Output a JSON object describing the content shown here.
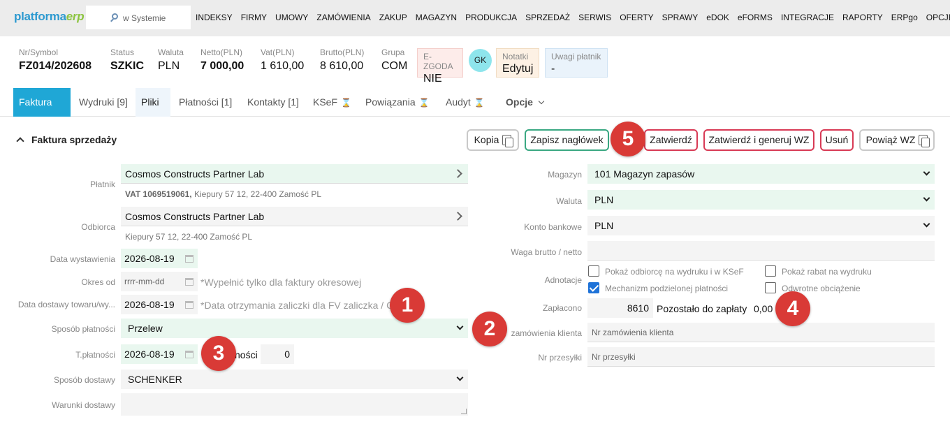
{
  "nav": {
    "logo_a": "platforma",
    "logo_b": "erp",
    "search_placeholder": "w Systemie",
    "menu": [
      "INDEKSY",
      "FIRMY",
      "UMOWY",
      "ZAMÓWIENIA",
      "ZAKUP",
      "MAGAZYN",
      "PRODUKCJA",
      "SPRZEDAŻ",
      "SERWIS",
      "OFERTY",
      "SPRAWY",
      "eDOK",
      "eFORMS",
      "INTEGRACJE",
      "RAPORTY",
      "ERPgo",
      "OPCJE"
    ]
  },
  "header": {
    "nr_label": "Nr/Symbol",
    "nr_value": "FZ014/202608",
    "status_label": "Status",
    "status_value": "SZKIC",
    "waluta_label": "Waluta",
    "waluta_value": "PLN",
    "netto_label": "Netto(PLN)",
    "netto_value": "7 000,00",
    "vat_label": "Vat(PLN)",
    "vat_value": "1 610,00",
    "brutto_label": "Brutto(PLN)",
    "brutto_value": "8 610,00",
    "grupa_label": "Grupa",
    "grupa_value": "COM",
    "ezgoda_label": "E-ZGODA",
    "ezgoda_value": "NIE",
    "avatar": "GK",
    "notatki_label": "Notatki",
    "notatki_value": "Edytuj",
    "uwagi_label": "Uwagi płatnik",
    "uwagi_value": "-",
    "colors": {
      "ezgoda_bg": "#fdecea",
      "notatki_bg": "#fdf1e4",
      "uwagi_bg": "#eaf3fb",
      "accent": "#1fa7d6"
    }
  },
  "tabs": {
    "faktura": "Faktura [1]",
    "wydruki": "Wydruki [9]",
    "pliki": "Pliki",
    "platnosci": "Płatności [1]",
    "kontakty": "Kontakty [1]",
    "ksef": "KSeF",
    "powiazania": "Powiązania",
    "audyt": "Audyt",
    "opcje": "Opcje"
  },
  "section": {
    "title": "Faktura sprzedaży",
    "buttons": {
      "kopia": "Kopia",
      "zapisz": "Zapisz nagłówek",
      "zatwierdz": "Zatwierdź",
      "zatwierdz_wz": "Zatwierdź i generuj WZ",
      "usun": "Usuń",
      "powiaz": "Powiąż WZ"
    }
  },
  "markers": [
    "1",
    "2",
    "3",
    "4",
    "5"
  ],
  "left_form": {
    "platnik_label": "Płatnik",
    "platnik_value": "Cosmos Constructs Partner Lab",
    "platnik_vat": "VAT 1069519061,",
    "platnik_addr": " Kiepury 57 12, 22-400 Zamość PL",
    "odbiorca_label": "Odbiorca",
    "odbiorca_value": "Cosmos Constructs Partner Lab",
    "odbiorca_addr": "Kiepury 57 12, 22-400 Zamość PL",
    "data_wyst_label": "Data wystawienia",
    "data_wyst_value": "2026-08-19",
    "okres_label": "Okres od",
    "okres_placeholder": "rrrr-mm-dd",
    "okres_hint": "*Wypełnić tylko dla faktury okresowej",
    "data_dost_label": "Data dostawy towaru/wy...",
    "data_dost_value": "2026-08-19",
    "data_dost_hint": "*Data otrzymania zaliczki dla FV zaliczka / C",
    "sposob_plat_label": "Sposób płatności",
    "sposob_plat_value": "Przelew",
    "tplat_label": "T.płatności",
    "tplat_value": "2026-08-19",
    "dni_label": "ności",
    "dni_value": "0",
    "sposob_dost_label": "Sposób dostawy",
    "sposob_dost_value": "SCHENKER",
    "warunki_label": "Warunki dostawy"
  },
  "right_form": {
    "magazyn_label": "Magazyn",
    "magazyn_value": "101 Magazyn zapasów",
    "waluta_label": "Waluta",
    "waluta_value": "PLN",
    "konto_label": "Konto bankowe",
    "konto_value": "PLN",
    "waga_label": "Waga brutto / netto",
    "adnotacje_label": "Adnotacje",
    "cb1": "Pokaż odbiorcę na wydruku i w KSeF",
    "cb2": "Pokaż rabat na wydruku",
    "cb3": "Mechanizm podzielonej płatności",
    "cb4": "Odwrotne obciążenie",
    "zaplacono_label": "Zapłacono",
    "zaplacono_value": "8610",
    "pozostalo_label": "Pozostało do zapłaty",
    "pozostalo_value": "0,00",
    "zam_label": "zamówienia klienta",
    "zam_placeholder": "Nr zamówienia klienta",
    "przesylki_label": "Nr przesyłki",
    "przesylki_placeholder": "Nr przesyłki"
  }
}
